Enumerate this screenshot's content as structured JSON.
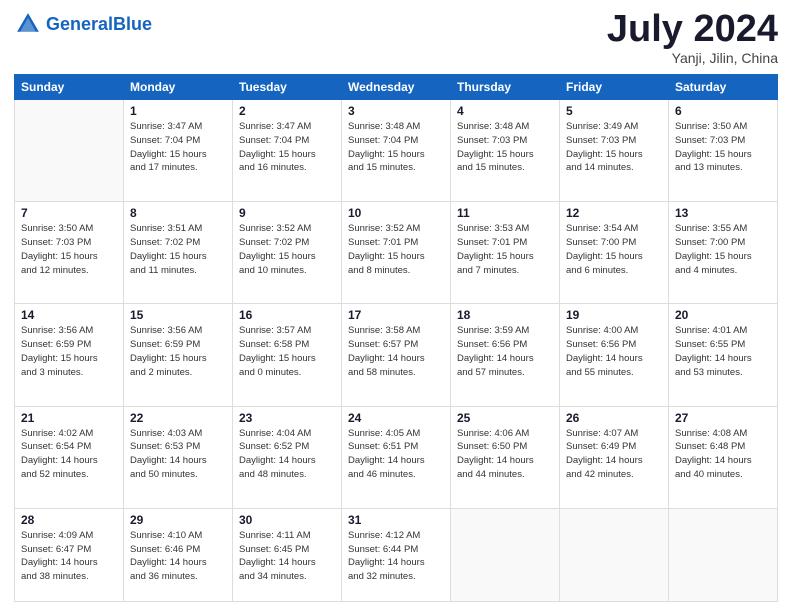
{
  "header": {
    "logo_text_regular": "General",
    "logo_text_blue": "Blue",
    "main_title": "July 2024",
    "subtitle": "Yanji, Jilin, China"
  },
  "calendar": {
    "days_of_week": [
      "Sunday",
      "Monday",
      "Tuesday",
      "Wednesday",
      "Thursday",
      "Friday",
      "Saturday"
    ],
    "weeks": [
      [
        {
          "day": "",
          "info": ""
        },
        {
          "day": "1",
          "info": "Sunrise: 3:47 AM\nSunset: 7:04 PM\nDaylight: 15 hours\nand 17 minutes."
        },
        {
          "day": "2",
          "info": "Sunrise: 3:47 AM\nSunset: 7:04 PM\nDaylight: 15 hours\nand 16 minutes."
        },
        {
          "day": "3",
          "info": "Sunrise: 3:48 AM\nSunset: 7:04 PM\nDaylight: 15 hours\nand 15 minutes."
        },
        {
          "day": "4",
          "info": "Sunrise: 3:48 AM\nSunset: 7:03 PM\nDaylight: 15 hours\nand 15 minutes."
        },
        {
          "day": "5",
          "info": "Sunrise: 3:49 AM\nSunset: 7:03 PM\nDaylight: 15 hours\nand 14 minutes."
        },
        {
          "day": "6",
          "info": "Sunrise: 3:50 AM\nSunset: 7:03 PM\nDaylight: 15 hours\nand 13 minutes."
        }
      ],
      [
        {
          "day": "7",
          "info": "Sunrise: 3:50 AM\nSunset: 7:03 PM\nDaylight: 15 hours\nand 12 minutes."
        },
        {
          "day": "8",
          "info": "Sunrise: 3:51 AM\nSunset: 7:02 PM\nDaylight: 15 hours\nand 11 minutes."
        },
        {
          "day": "9",
          "info": "Sunrise: 3:52 AM\nSunset: 7:02 PM\nDaylight: 15 hours\nand 10 minutes."
        },
        {
          "day": "10",
          "info": "Sunrise: 3:52 AM\nSunset: 7:01 PM\nDaylight: 15 hours\nand 8 minutes."
        },
        {
          "day": "11",
          "info": "Sunrise: 3:53 AM\nSunset: 7:01 PM\nDaylight: 15 hours\nand 7 minutes."
        },
        {
          "day": "12",
          "info": "Sunrise: 3:54 AM\nSunset: 7:00 PM\nDaylight: 15 hours\nand 6 minutes."
        },
        {
          "day": "13",
          "info": "Sunrise: 3:55 AM\nSunset: 7:00 PM\nDaylight: 15 hours\nand 4 minutes."
        }
      ],
      [
        {
          "day": "14",
          "info": "Sunrise: 3:56 AM\nSunset: 6:59 PM\nDaylight: 15 hours\nand 3 minutes."
        },
        {
          "day": "15",
          "info": "Sunrise: 3:56 AM\nSunset: 6:59 PM\nDaylight: 15 hours\nand 2 minutes."
        },
        {
          "day": "16",
          "info": "Sunrise: 3:57 AM\nSunset: 6:58 PM\nDaylight: 15 hours\nand 0 minutes."
        },
        {
          "day": "17",
          "info": "Sunrise: 3:58 AM\nSunset: 6:57 PM\nDaylight: 14 hours\nand 58 minutes."
        },
        {
          "day": "18",
          "info": "Sunrise: 3:59 AM\nSunset: 6:56 PM\nDaylight: 14 hours\nand 57 minutes."
        },
        {
          "day": "19",
          "info": "Sunrise: 4:00 AM\nSunset: 6:56 PM\nDaylight: 14 hours\nand 55 minutes."
        },
        {
          "day": "20",
          "info": "Sunrise: 4:01 AM\nSunset: 6:55 PM\nDaylight: 14 hours\nand 53 minutes."
        }
      ],
      [
        {
          "day": "21",
          "info": "Sunrise: 4:02 AM\nSunset: 6:54 PM\nDaylight: 14 hours\nand 52 minutes."
        },
        {
          "day": "22",
          "info": "Sunrise: 4:03 AM\nSunset: 6:53 PM\nDaylight: 14 hours\nand 50 minutes."
        },
        {
          "day": "23",
          "info": "Sunrise: 4:04 AM\nSunset: 6:52 PM\nDaylight: 14 hours\nand 48 minutes."
        },
        {
          "day": "24",
          "info": "Sunrise: 4:05 AM\nSunset: 6:51 PM\nDaylight: 14 hours\nand 46 minutes."
        },
        {
          "day": "25",
          "info": "Sunrise: 4:06 AM\nSunset: 6:50 PM\nDaylight: 14 hours\nand 44 minutes."
        },
        {
          "day": "26",
          "info": "Sunrise: 4:07 AM\nSunset: 6:49 PM\nDaylight: 14 hours\nand 42 minutes."
        },
        {
          "day": "27",
          "info": "Sunrise: 4:08 AM\nSunset: 6:48 PM\nDaylight: 14 hours\nand 40 minutes."
        }
      ],
      [
        {
          "day": "28",
          "info": "Sunrise: 4:09 AM\nSunset: 6:47 PM\nDaylight: 14 hours\nand 38 minutes."
        },
        {
          "day": "29",
          "info": "Sunrise: 4:10 AM\nSunset: 6:46 PM\nDaylight: 14 hours\nand 36 minutes."
        },
        {
          "day": "30",
          "info": "Sunrise: 4:11 AM\nSunset: 6:45 PM\nDaylight: 14 hours\nand 34 minutes."
        },
        {
          "day": "31",
          "info": "Sunrise: 4:12 AM\nSunset: 6:44 PM\nDaylight: 14 hours\nand 32 minutes."
        },
        {
          "day": "",
          "info": ""
        },
        {
          "day": "",
          "info": ""
        },
        {
          "day": "",
          "info": ""
        }
      ]
    ]
  }
}
